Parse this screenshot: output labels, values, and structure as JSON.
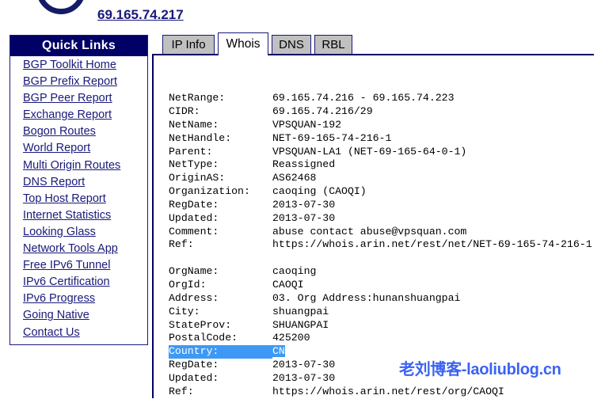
{
  "header": {
    "logo_icon": "hurricane-electric-circle-logo",
    "ip_title": "69.165.74.217"
  },
  "sidebar": {
    "title": "Quick Links",
    "items": [
      {
        "label": "BGP Toolkit Home"
      },
      {
        "label": "BGP Prefix Report"
      },
      {
        "label": "BGP Peer Report"
      },
      {
        "label": "Exchange Report"
      },
      {
        "label": "Bogon Routes"
      },
      {
        "label": "World Report"
      },
      {
        "label": "Multi Origin Routes"
      },
      {
        "label": "DNS Report"
      },
      {
        "label": "Top Host Report"
      },
      {
        "label": "Internet Statistics"
      },
      {
        "label": "Looking Glass"
      },
      {
        "label": "Network Tools App"
      },
      {
        "label": "Free IPv6 Tunnel"
      },
      {
        "label": "IPv6 Certification"
      },
      {
        "label": "IPv6 Progress"
      },
      {
        "label": "Going Native"
      },
      {
        "label": "Contact Us"
      }
    ]
  },
  "tabs": [
    {
      "label": "IP Info",
      "active": false
    },
    {
      "label": "Whois",
      "active": true
    },
    {
      "label": "DNS",
      "active": false
    },
    {
      "label": "RBL",
      "active": false
    }
  ],
  "whois": {
    "lines": [
      {
        "key": "NetRange:",
        "value": "69.165.74.216 - 69.165.74.223"
      },
      {
        "key": "CIDR:",
        "value": "69.165.74.216/29"
      },
      {
        "key": "NetName:",
        "value": "VPSQUAN-192"
      },
      {
        "key": "NetHandle:",
        "value": "NET-69-165-74-216-1"
      },
      {
        "key": "Parent:",
        "value": "VPSQUAN-LA1 (NET-69-165-64-0-1)"
      },
      {
        "key": "NetType:",
        "value": "Reassigned"
      },
      {
        "key": "OriginAS:",
        "value": "AS62468"
      },
      {
        "key": "Organization:",
        "value": "caoqing (CAOQI)"
      },
      {
        "key": "RegDate:",
        "value": "2013-07-30"
      },
      {
        "key": "Updated:",
        "value": "2013-07-30"
      },
      {
        "key": "Comment:",
        "value": "abuse contact abuse@vpsquan.com"
      },
      {
        "key": "Ref:",
        "value": "https://whois.arin.net/rest/net/NET-69-165-74-216-1"
      },
      {
        "key": "",
        "value": ""
      },
      {
        "key": "OrgName:",
        "value": "caoqing"
      },
      {
        "key": "OrgId:",
        "value": "CAOQI"
      },
      {
        "key": "Address:",
        "value": "03. Org Address:hunanshuangpai"
      },
      {
        "key": "City:",
        "value": "shuangpai"
      },
      {
        "key": "StateProv:",
        "value": "SHUANGPAI"
      },
      {
        "key": "PostalCode:",
        "value": "425200"
      },
      {
        "key": "Country:",
        "value": "CN",
        "selected": true
      },
      {
        "key": "RegDate:",
        "value": "2013-07-30"
      },
      {
        "key": "Updated:",
        "value": "2013-07-30"
      },
      {
        "key": "Ref:",
        "value": "https://whois.arin.net/rest/org/CAOQI"
      }
    ]
  },
  "watermark": {
    "text": "老刘博客-laoliublog.cn"
  },
  "colors": {
    "navy": "#000066",
    "link": "#19197a",
    "tab_inactive": "#c0c0c0",
    "selection": "#3d99f5",
    "watermark": "#3b62f0"
  }
}
